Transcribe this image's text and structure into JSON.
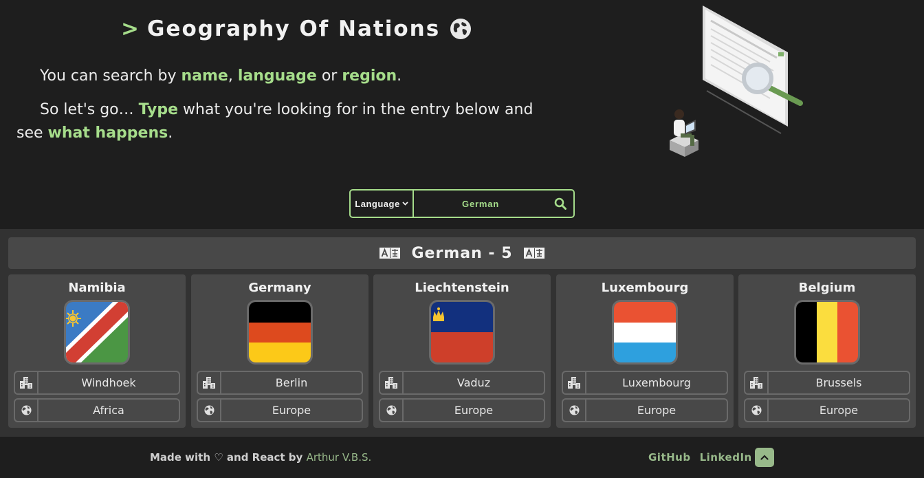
{
  "hero": {
    "caret": ">",
    "title": "Geography Of Nations",
    "intro_line1": {
      "prefix": "You can search by ",
      "name": "name",
      "comma": ", ",
      "language": "language",
      "or": " or ",
      "region": "region",
      "end": "."
    },
    "intro_line2": {
      "prefix": "So let's go… ",
      "type": "Type",
      "middle": " what you're looking for in the entry below and see ",
      "happens": "what happens",
      "end": "."
    }
  },
  "search": {
    "filter_selected": "Language",
    "query": "German"
  },
  "results": {
    "heading": "German - 5",
    "countries": [
      {
        "name": "Namibia",
        "capital": "Windhoek",
        "region": "Africa"
      },
      {
        "name": "Germany",
        "capital": "Berlin",
        "region": "Europe"
      },
      {
        "name": "Liechtenstein",
        "capital": "Vaduz",
        "region": "Europe"
      },
      {
        "name": "Luxembourg",
        "capital": "Luxembourg",
        "region": "Europe"
      },
      {
        "name": "Belgium",
        "capital": "Brussels",
        "region": "Europe"
      }
    ]
  },
  "footer": {
    "made_with": "Made with ♡ and React by ",
    "author": "Arthur V.B.S.",
    "github": "GitHub",
    "linkedin": "LinkedIn"
  },
  "colors": {
    "accent": "#a6dd8b",
    "footer_link": "#98b98a",
    "background": "#1e1e1e",
    "results_bg": "#323232",
    "card_bg": "#484848"
  },
  "icons": {
    "globe_title": "earth-icon",
    "search": "search-icon",
    "translate": "translate-icon",
    "capital": "city-icon",
    "region": "globe-icon",
    "back_to_top": "chevron-up-icon"
  }
}
